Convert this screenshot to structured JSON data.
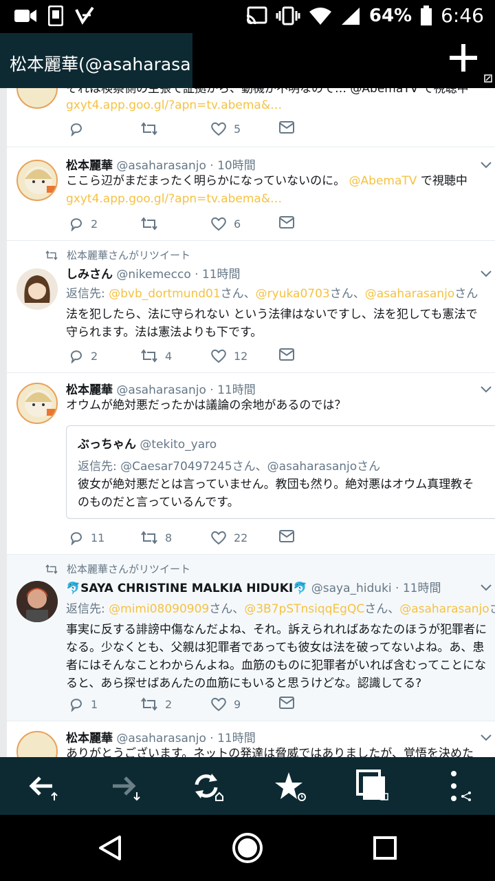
{
  "status_bar": {
    "battery": "64%",
    "time": "6:46"
  },
  "app_bar": {
    "tab_title": "松本麗華(@asaharasa…",
    "add_icon": "plus-icon"
  },
  "tweets": {
    "t0": {
      "body_partial": "それは検察側の主張で証拠から、動機が不明なので… @AbemaTV で視聴中",
      "link": "gxyt4.app.goo.gl/?apn=tv.abema&…",
      "likes": "5"
    },
    "t1": {
      "name": "松本麗華",
      "handle": "@asaharasanjo",
      "time": " · 10時間",
      "body": "ここら辺がまだまったく明らかになっていないのに。",
      "mention": "@AbemaTV",
      "suffix": " で視聴中",
      "link": "gxyt4.app.goo.gl/?apn=tv.abema&…",
      "replies": "2",
      "likes": "6"
    },
    "t2": {
      "rt_label": "松本麗華さんがリツイート",
      "name": "しみさん",
      "handle": "@nikemecco",
      "time": " · 11時間",
      "reply_label": "返信先: ",
      "reply_1": "@bvb_dortmund01",
      "reply_sep1": "さん、",
      "reply_2": "@ryuka0703",
      "reply_sep2": "さん、",
      "reply_3": "@asaharasanjo",
      "reply_end": "さん",
      "body_1": "法を犯したら、法に守られない という法律はないですし、法を犯しても憲法で",
      "body_2": "守られます。法は憲法よりも下です。",
      "replies": "2",
      "retweets": "4",
      "likes": "12"
    },
    "t3": {
      "name": "松本麗華",
      "handle": "@asaharasanjo",
      "time": " · 11時間",
      "body": "オウムが絶対悪だったかは議論の余地があるのでは？",
      "quote_name": "ぶっちゃん",
      "quote_handle": "@tekito_yaro",
      "quote_reply": "返信先: @Caesar70497245さん、@asaharasanjoさん",
      "quote_body_1": "彼女が絶対悪だとは言っていません。教団も然り。絶対悪はオウム真理教そ",
      "quote_body_2": "のものだと言っているんです。",
      "replies": "11",
      "retweets": "8",
      "likes": "22"
    },
    "t4": {
      "rt_label": "松本麗華さんがリツイート",
      "name": "🐬SAYA CHRISTINE MALKIA HIDUKI🐬",
      "handle": "@saya_hiduki",
      "time": " · 11時間",
      "reply_label": "返信先: ",
      "reply_1": "@mimi08090909",
      "reply_sep1": "さん、",
      "reply_2": "@3B7pSTnsiqqEgQC",
      "reply_sep2": "さん、",
      "reply_3": "@asaharasanjo",
      "reply_end": "さん",
      "body_1": "事実に反する誹謗中傷なんだよね、それ。訴えられればあなたのほうが犯罪者に",
      "body_2": "なる。少なくとも、父親は犯罪者であっても彼女は法を破ってないよね。あ、患",
      "body_3": "者にはそんなことわからんよね。血筋のものに犯罪者がいれば含むってことにな",
      "body_4": "ると、あら探せばあんたの血筋にもいると思うけどな。認識してる?",
      "replies": "1",
      "retweets": "2",
      "likes": "9"
    },
    "t5": {
      "name": "松本麗華",
      "handle": "@asaharasanjo",
      "time": " · 11時間",
      "body_partial": "ありがとうございます。ネットの発達は脅威ではありましたが、覚悟を決めた"
    }
  },
  "accent_colors": {
    "link": "#f5c242",
    "toolbar": "#0d2a33",
    "muted": "#657786"
  }
}
